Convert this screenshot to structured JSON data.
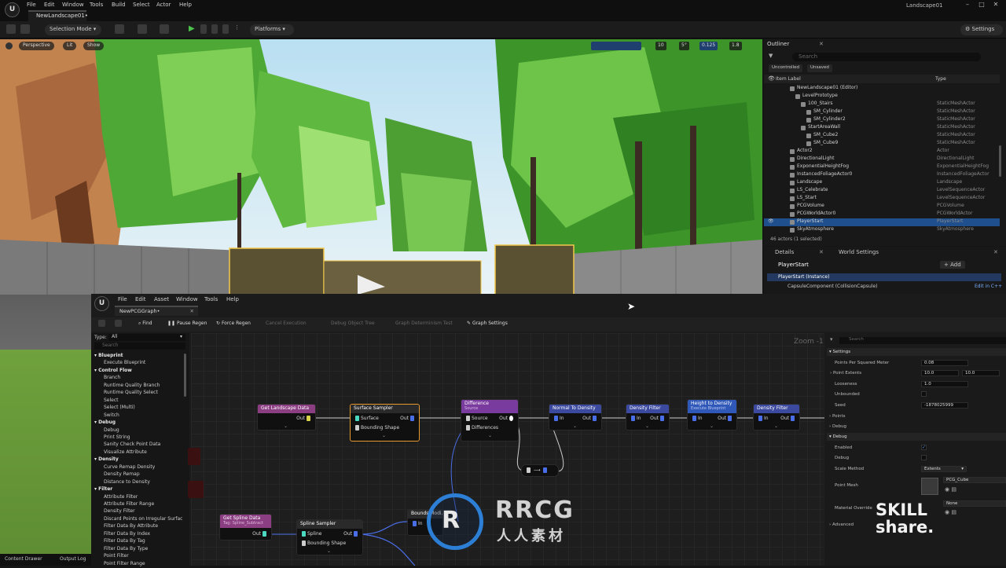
{
  "app": {
    "logo": "ue-logo",
    "menu": [
      "File",
      "Edit",
      "Window",
      "Tools",
      "Build",
      "Select",
      "Actor",
      "Help"
    ],
    "level_tab": "NewLandscape01•",
    "window_title": "Landscape01"
  },
  "toolbar": {
    "selection_mode": "Selection Mode",
    "platforms": "Platforms",
    "settings": "Settings"
  },
  "viewport": {
    "perspective": "Perspective",
    "lit": "Lit",
    "show": "Show",
    "grid_snap": "10",
    "rot_snap": "5°",
    "scale_snap": "0.125",
    "cam_speed": "1.8"
  },
  "outliner": {
    "tab": "Outliner",
    "search_placeholder": "Search",
    "filter_uncontrolled": "Uncontrolled",
    "filter_unsaved": "Unsaved",
    "col_label": "Item Label",
    "col_type": "Type",
    "rows": [
      {
        "name": "NewLandscape01 (Editor)",
        "type": "",
        "indent": 0
      },
      {
        "name": "LevelPrototype",
        "type": "",
        "indent": 1
      },
      {
        "name": "100_Stairs",
        "type": "StaticMeshActor",
        "indent": 2
      },
      {
        "name": "SM_Cylinder",
        "type": "StaticMeshActor",
        "indent": 3
      },
      {
        "name": "SM_Cylinder2",
        "type": "StaticMeshActor",
        "indent": 3
      },
      {
        "name": "StartAreaWall",
        "type": "StaticMeshActor",
        "indent": 2
      },
      {
        "name": "SM_Cube2",
        "type": "StaticMeshActor",
        "indent": 3
      },
      {
        "name": "SM_Cube9",
        "type": "StaticMeshActor",
        "indent": 3
      },
      {
        "name": "Actor2",
        "type": "Actor",
        "indent": 0
      },
      {
        "name": "DirectionalLight",
        "type": "DirectionalLight",
        "indent": 0
      },
      {
        "name": "ExponentialHeightFog",
        "type": "ExponentialHeightFog",
        "indent": 0
      },
      {
        "name": "InstancedFoliageActor0",
        "type": "InstancedFoliageActor",
        "indent": 0
      },
      {
        "name": "Landscape",
        "type": "Landscape",
        "indent": 0
      },
      {
        "name": "LS_Celebrate",
        "type": "LevelSequenceActor",
        "indent": 0
      },
      {
        "name": "LS_Start",
        "type": "LevelSequenceActor",
        "indent": 0
      },
      {
        "name": "PCGVolume",
        "type": "PCGVolume",
        "indent": 0
      },
      {
        "name": "PCGWorldActor0",
        "type": "PCGWorldActor",
        "indent": 0
      },
      {
        "name": "PlayerStart",
        "type": "PlayerStart",
        "indent": 0,
        "selected": true
      },
      {
        "name": "SkyAtmosphere",
        "type": "SkyAtmosphere",
        "indent": 0
      }
    ],
    "count": "46 actors (1 selected)"
  },
  "details": {
    "tab_details": "Details",
    "tab_world": "World Settings",
    "actor": "PlayerStart",
    "add": "+ Add",
    "instance": "PlayerStart (Instance)",
    "component": "CapsuleComponent (CollisionCapsule)",
    "edit_cpp": "Edit in C++"
  },
  "pcg": {
    "menu": [
      "File",
      "Edit",
      "Asset",
      "Window",
      "Tools",
      "Help"
    ],
    "tab": "NewPCGGraph•",
    "toolbar": [
      "Find",
      "Pause Regen",
      "Force Regen",
      "Cancel Execution",
      "Debug Object Tree",
      "Graph Determinism Test",
      "Graph Settings"
    ],
    "zoom": "Zoom -1",
    "palette_type_label": "Type:",
    "palette_type_value": "All",
    "palette_search": "Search",
    "palette": [
      {
        "t": "Blueprint",
        "h": true
      },
      {
        "t": "Execute Blueprint"
      },
      {
        "t": "Control Flow",
        "h": true
      },
      {
        "t": "Branch"
      },
      {
        "t": "Runtime Quality Branch"
      },
      {
        "t": "Runtime Quality Select"
      },
      {
        "t": "Select"
      },
      {
        "t": "Select (Multi)"
      },
      {
        "t": "Switch"
      },
      {
        "t": "Debug",
        "h": true
      },
      {
        "t": "Debug"
      },
      {
        "t": "Print String"
      },
      {
        "t": "Sanity Check Point Data"
      },
      {
        "t": "Visualize Attribute"
      },
      {
        "t": "Density",
        "h": true
      },
      {
        "t": "Curve Remap Density"
      },
      {
        "t": "Density Remap"
      },
      {
        "t": "Distance to Density"
      },
      {
        "t": "Filter",
        "h": true
      },
      {
        "t": "Attribute Filter"
      },
      {
        "t": "Attribute Filter Range"
      },
      {
        "t": "Density Filter"
      },
      {
        "t": "Discard Points on Irregular Surfac"
      },
      {
        "t": "Filter Data By Attribute"
      },
      {
        "t": "Filter Data By Index"
      },
      {
        "t": "Filter Data By Tag"
      },
      {
        "t": "Filter Data By Type"
      },
      {
        "t": "Point Filter"
      },
      {
        "t": "Point Filter Range"
      }
    ],
    "nodes": {
      "get_landscape": "Get Landscape Data",
      "surface_sampler": "Surface Sampler",
      "difference": "Difference",
      "difference_sub": "Source",
      "normal_to_density": "Normal To Density",
      "density_filter": "Density Filter",
      "height_to_density": "Height to Density",
      "height_sub": "Execute Blueprint",
      "density_filter2": "Density Filter",
      "get_spline": "Get Spline Data",
      "get_spline_sub": "Tag: Spline_Subtract",
      "spline_sampler": "Spline Sampler",
      "bounds": "Bounds Modi...",
      "pin_out": "Out",
      "pin_in": "In",
      "pin_surface": "Surface",
      "pin_bounding": "Bounding Shape",
      "pin_source": "Source",
      "pin_differences": "Differences",
      "pin_spline": "Spline"
    },
    "settings": {
      "search": "Search",
      "section": "Settings",
      "rows": [
        {
          "label": "Points Per Squared Meter",
          "value": "0.08"
        },
        {
          "label": "Point Extents",
          "value": "10.0",
          "value2": "10.0"
        },
        {
          "label": "Looseness",
          "value": "1.0"
        },
        {
          "label": "Unbounded",
          "value": ""
        },
        {
          "label": "Seed",
          "value": "-1878025999"
        }
      ],
      "points": "Points",
      "debug": "Debug",
      "debug_section": "Debug",
      "enabled": "Enabled",
      "debug_row": "Debug",
      "scale_method": "Scale Method",
      "scale_value": "Extents",
      "point_mesh": "Point Mesh",
      "point_mesh_value": "PCG_Cube",
      "material_override": "Material Override",
      "material_value": "None",
      "advanced": "Advanced"
    }
  },
  "bottom": {
    "content_drawer": "Content Drawer",
    "output_log": "Output Log"
  },
  "watermark": {
    "rrcg": "RRCG",
    "cn": "人人素材",
    "skillshare": "SKILL share."
  }
}
